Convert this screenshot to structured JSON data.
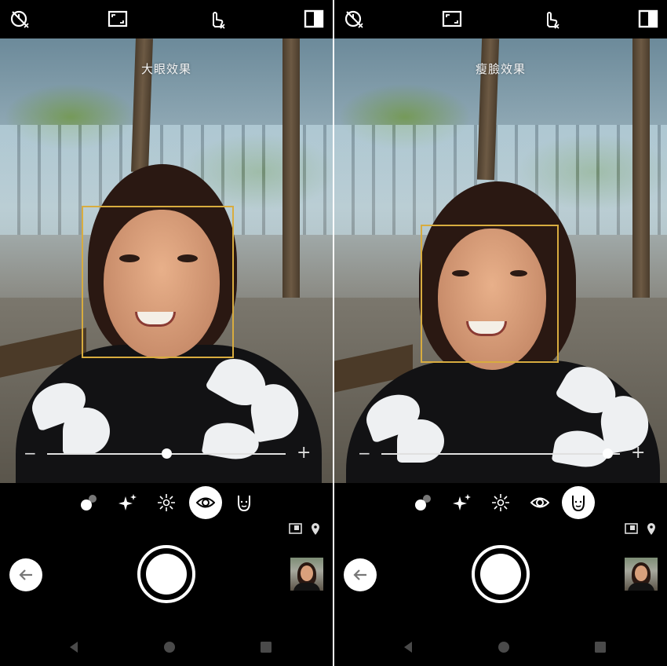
{
  "panels": [
    {
      "mode_label": "大眼效果",
      "slider_value_fraction": 0.5,
      "selected_effect": "eye-enlarge",
      "slider_minus": "−",
      "slider_plus": "+"
    },
    {
      "mode_label": "瘦臉效果",
      "slider_value_fraction": 0.95,
      "selected_effect": "face-slim",
      "slider_minus": "−",
      "slider_plus": "+"
    }
  ],
  "top_bar_icons": [
    "timer-off-icon",
    "aspect-ratio-icon",
    "touch-shutter-off-icon",
    "beauty-compare-icon"
  ],
  "effects": [
    "bokeh-icon",
    "sparkle-icon",
    "brightness-icon",
    "eye-enlarge-icon",
    "face-slim-icon"
  ],
  "bottom_icons": [
    "photo-info-icon",
    "location-pin-icon"
  ],
  "nav_icons": [
    "back-triangle-icon",
    "home-circle-icon",
    "recents-square-icon"
  ],
  "colors": {
    "face_box": "#d8ac3f",
    "background": "#000000",
    "control": "#ffffff"
  }
}
